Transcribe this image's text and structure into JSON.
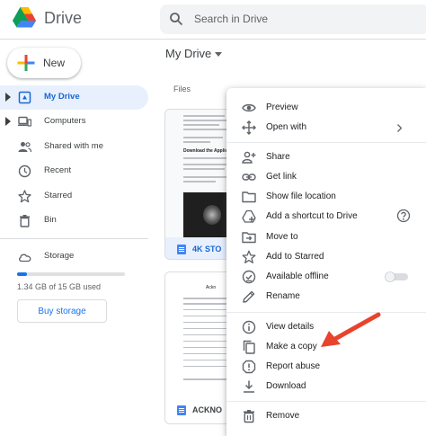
{
  "header": {
    "brand": "Drive",
    "search_placeholder": "Search in Drive"
  },
  "new_button": {
    "label": "New"
  },
  "sidebar": {
    "items": [
      {
        "label": "My Drive",
        "icon": "my-drive-icon",
        "active": true,
        "expandable": true
      },
      {
        "label": "Computers",
        "icon": "computers-icon",
        "active": false,
        "expandable": true
      },
      {
        "label": "Shared with me",
        "icon": "shared-icon",
        "active": false,
        "expandable": false
      },
      {
        "label": "Recent",
        "icon": "clock-icon",
        "active": false,
        "expandable": false
      },
      {
        "label": "Starred",
        "icon": "star-icon",
        "active": false,
        "expandable": false
      },
      {
        "label": "Bin",
        "icon": "bin-icon",
        "active": false,
        "expandable": false
      }
    ],
    "storage": {
      "label": "Storage",
      "usage_text": "1.34 GB of 15 GB used",
      "used_fraction": 0.089,
      "buy_label": "Buy storage"
    }
  },
  "main": {
    "title": "My Drive",
    "section_label": "Files",
    "cards": [
      {
        "name": "4K STO",
        "heading": "Download the Applic",
        "selected": true
      },
      {
        "name": "ACKNO",
        "heading": "Ackn",
        "selected": false
      }
    ]
  },
  "context_menu": {
    "items": [
      {
        "label": "Preview",
        "icon": "eye-icon"
      },
      {
        "label": "Open with",
        "icon": "open-with-icon",
        "submenu": true
      },
      {
        "label": "Share",
        "icon": "person-add-icon"
      },
      {
        "label": "Get link",
        "icon": "link-icon"
      },
      {
        "label": "Show file location",
        "icon": "folder-icon"
      },
      {
        "label": "Add a shortcut to Drive",
        "icon": "shortcut-icon",
        "help": true
      },
      {
        "label": "Move to",
        "icon": "move-to-icon"
      },
      {
        "label": "Add to Starred",
        "icon": "star-icon"
      },
      {
        "label": "Available offline",
        "icon": "offline-icon",
        "toggle": false
      },
      {
        "label": "Rename",
        "icon": "pencil-icon"
      },
      {
        "label": "View details",
        "icon": "info-icon"
      },
      {
        "label": "Make a copy",
        "icon": "copy-icon"
      },
      {
        "label": "Report abuse",
        "icon": "report-icon"
      },
      {
        "label": "Download",
        "icon": "download-icon"
      },
      {
        "label": "Remove",
        "icon": "trash-icon"
      }
    ]
  },
  "colors": {
    "accent": "#1a73e8",
    "active_bg": "#e8f0fe",
    "annotation_arrow": "#e8432d"
  }
}
